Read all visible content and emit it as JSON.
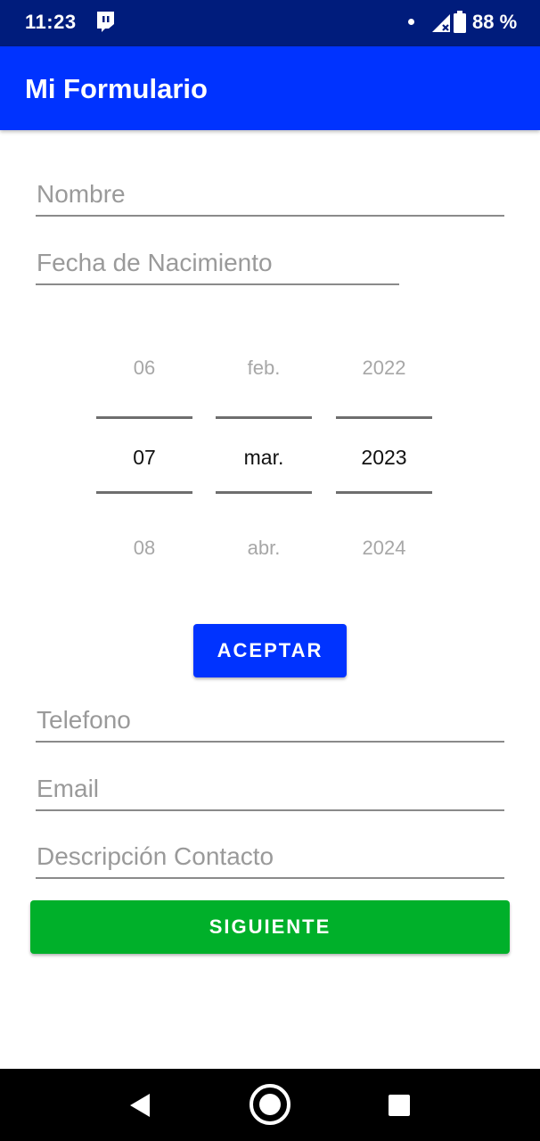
{
  "status_bar": {
    "time": "11:23",
    "battery": "88 %",
    "icons": [
      "twitch-icon",
      "notification-dot-icon",
      "signal-no-data-icon",
      "battery-icon"
    ]
  },
  "app_bar": {
    "title": "Mi Formulario"
  },
  "form": {
    "nombre_placeholder": "Nombre",
    "fecha_placeholder": "Fecha de Nacimiento",
    "telefono_placeholder": "Telefono",
    "email_placeholder": "Email",
    "descripcion_placeholder": "Descripción Contacto"
  },
  "date_picker": {
    "day": {
      "prev": "06",
      "selected": "07",
      "next": "08"
    },
    "month": {
      "prev": "feb.",
      "selected": "mar.",
      "next": "abr."
    },
    "year": {
      "prev": "2022",
      "selected": "2023",
      "next": "2024"
    }
  },
  "buttons": {
    "aceptar": "ACEPTAR",
    "siguiente": "SIGUIENTE"
  },
  "colors": {
    "status_bar": "#001c7c",
    "app_bar": "#0033ff",
    "accept_button": "#0033ff",
    "next_button": "#00b02a",
    "nav_bar": "#000000"
  },
  "nav_bar": {
    "icons": [
      "back-icon",
      "home-icon",
      "recent-apps-icon"
    ]
  }
}
